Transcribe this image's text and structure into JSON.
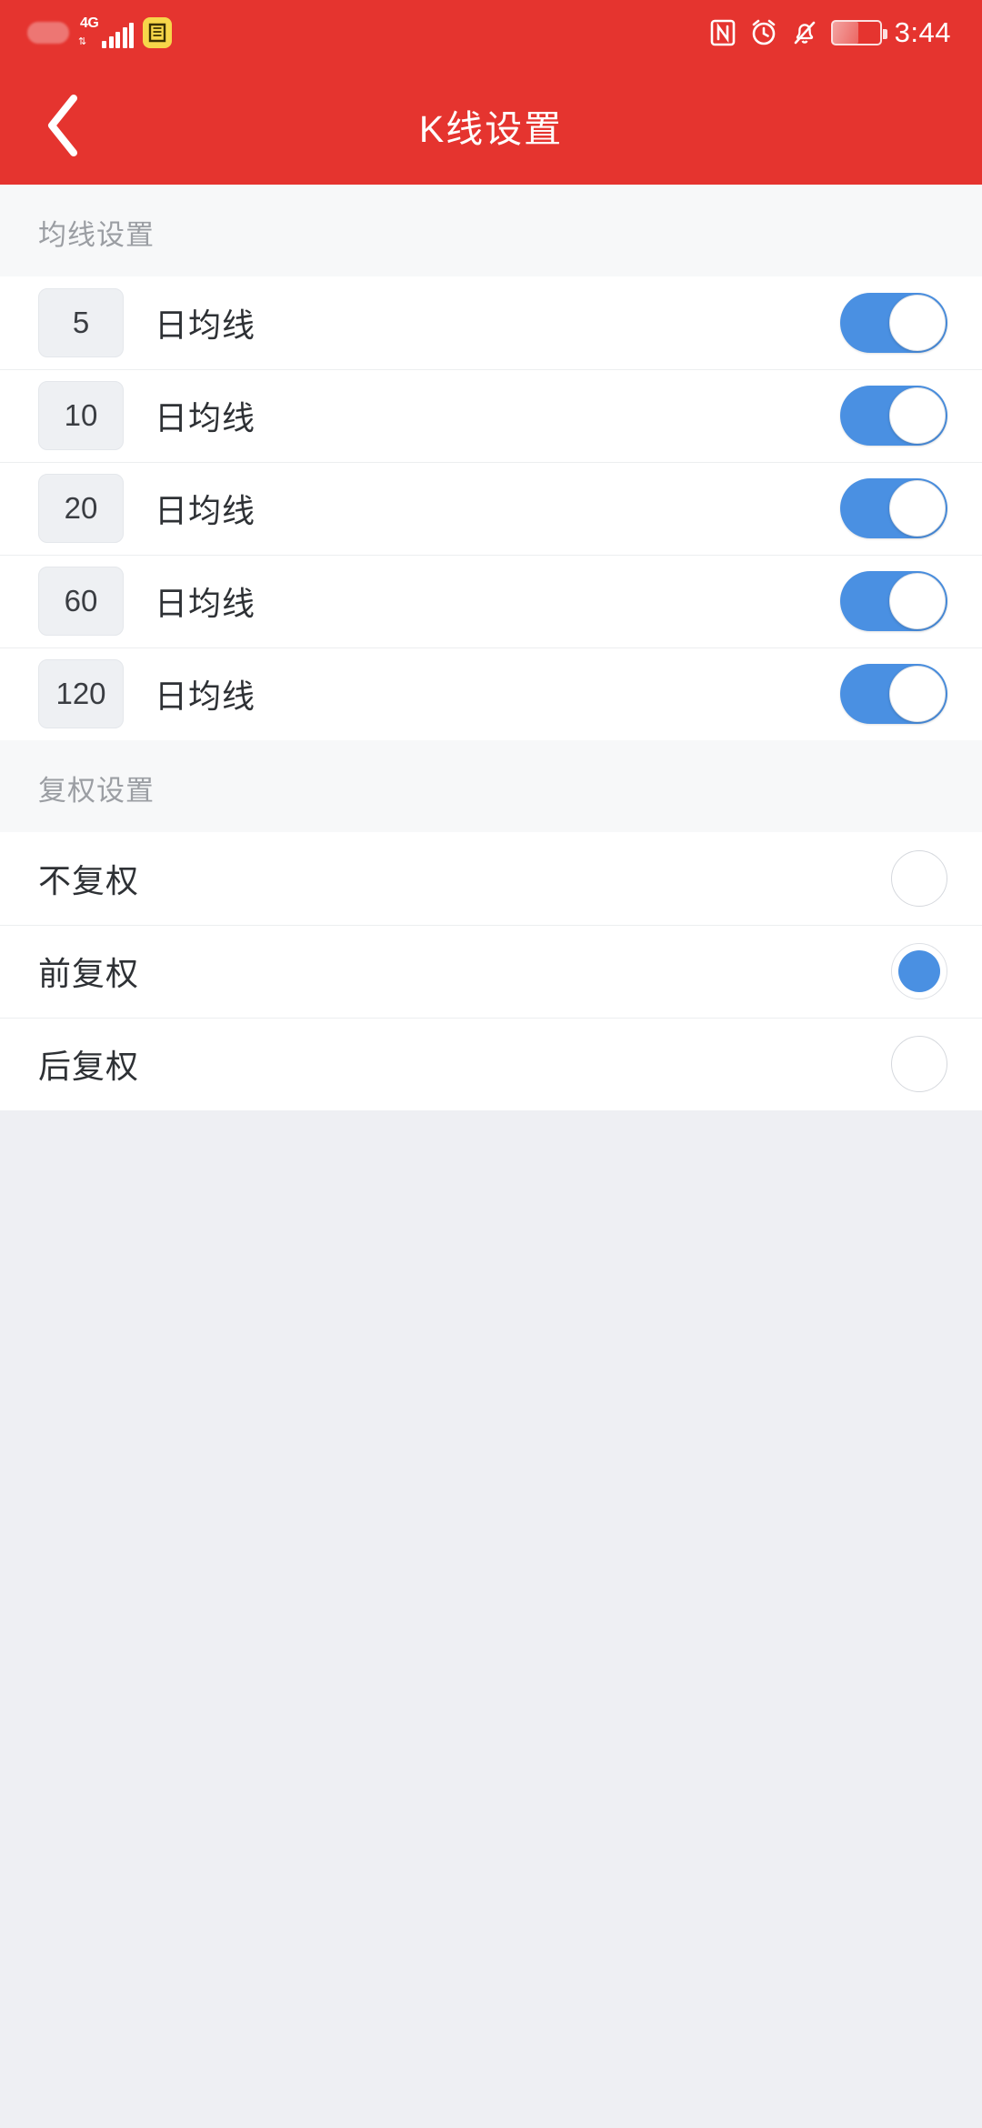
{
  "status_bar": {
    "network_type": "4G",
    "time": "3:44",
    "icons": [
      "blurred-icon",
      "signal-bars-icon",
      "app-badge-icon",
      "nfc-icon",
      "alarm-clock-icon",
      "bell-muted-icon",
      "battery-icon"
    ]
  },
  "header": {
    "title": "K线设置",
    "back_icon": "chevron-left-icon",
    "background_color": "#e5342f"
  },
  "sections": [
    {
      "title": "均线设置",
      "type": "moving-average",
      "rows": [
        {
          "value": "5",
          "label": "日均线",
          "enabled": true
        },
        {
          "value": "10",
          "label": "日均线",
          "enabled": true
        },
        {
          "value": "20",
          "label": "日均线",
          "enabled": true
        },
        {
          "value": "60",
          "label": "日均线",
          "enabled": true
        },
        {
          "value": "120",
          "label": "日均线",
          "enabled": true
        }
      ]
    },
    {
      "title": "复权设置",
      "type": "adjustment",
      "options": [
        {
          "label": "不复权",
          "selected": false
        },
        {
          "label": "前复权",
          "selected": true
        },
        {
          "label": "后复权",
          "selected": false
        }
      ]
    }
  ],
  "colors": {
    "accent": "#4a90e2",
    "header": "#e5342f",
    "page_background": "#eeeff3",
    "section_header_background": "#f7f8f9",
    "card_background": "#ffffff"
  }
}
